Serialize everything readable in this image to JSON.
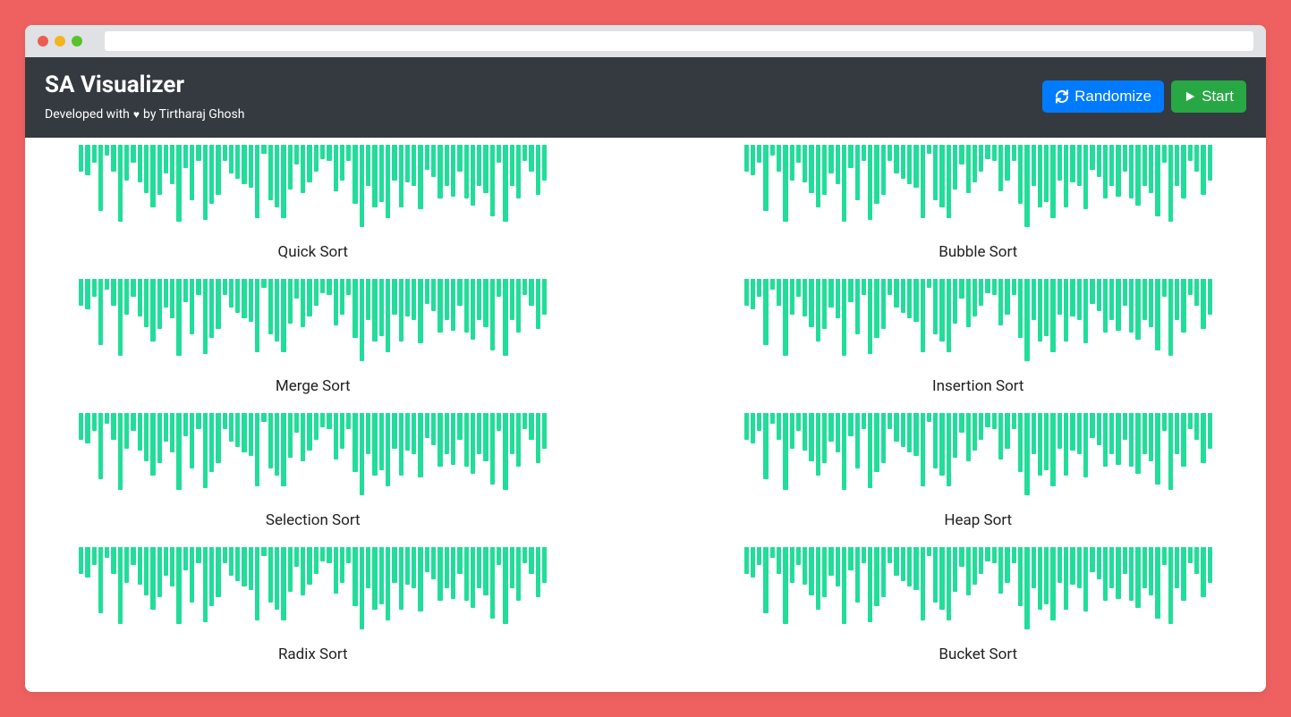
{
  "brand": {
    "title": "SA Visualizer",
    "sub_prefix": "Developed with",
    "sub_suffix": "by Tirtharaj Ghosh"
  },
  "actions": {
    "randomize_label": "Randomize",
    "start_label": "Start"
  },
  "panels": [
    {
      "label": "Quick Sort"
    },
    {
      "label": "Bubble Sort"
    },
    {
      "label": "Merge Sort"
    },
    {
      "label": "Insertion Sort"
    },
    {
      "label": "Selection Sort"
    },
    {
      "label": "Heap Sort"
    },
    {
      "label": "Radix Sort"
    },
    {
      "label": "Bucket Sort"
    }
  ],
  "chart_data": {
    "type": "bar",
    "note": "All eight panels share the same randomized array; values are relative bar heights 0–100.",
    "values": [
      30,
      34,
      20,
      74,
      12,
      30,
      86,
      40,
      20,
      42,
      54,
      70,
      56,
      32,
      44,
      86,
      26,
      62,
      18,
      84,
      66,
      56,
      18,
      32,
      38,
      44,
      48,
      82,
      10,
      62,
      70,
      82,
      50,
      22,
      54,
      42,
      30,
      16,
      18,
      52,
      40,
      18,
      66,
      92,
      46,
      70,
      64,
      82,
      40,
      70,
      42,
      46,
      72,
      28,
      36,
      60,
      46,
      58,
      30,
      60,
      68,
      46,
      54,
      80,
      20,
      86,
      46,
      60,
      18,
      30,
      56,
      40
    ]
  },
  "colors": {
    "bar": "#22dd99",
    "navbar": "#343a40",
    "primary": "#007bff",
    "success": "#28a745",
    "page_bg": "#ee6160"
  }
}
